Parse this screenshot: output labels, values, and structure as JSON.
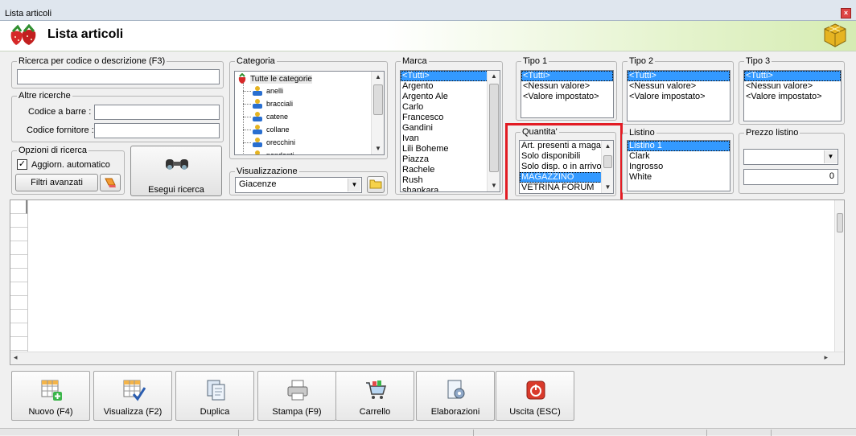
{
  "window": {
    "title": "Lista articoli",
    "header": "Lista articoli"
  },
  "search": {
    "legend": "Ricerca per codice o descrizione (F3)",
    "value": ""
  },
  "altre": {
    "legend": "Altre ricerche",
    "barcode_label": "Codice a barre :",
    "fornitore_label": "Codice fornitore :"
  },
  "opzioni": {
    "legend": "Opzioni di ricerca",
    "auto_label": "Aggiorn. automatico",
    "auto_checked": true,
    "filtri_label": "Filtri avanzati"
  },
  "esegui_label": "Esegui ricerca",
  "categoria": {
    "legend": "Categoria",
    "root": "Tutte le categorie",
    "items": [
      "anelli",
      "bracciali",
      "catene",
      "collane",
      "orecchini",
      "pendenti"
    ]
  },
  "visualizzazione": {
    "legend": "Visualizzazione",
    "selected": "Giacenze"
  },
  "marca": {
    "legend": "Marca",
    "items": [
      "<Tutti>",
      "Argento",
      "Argento Ale",
      "Carlo",
      "Francesco",
      "Gandini",
      "Ivan",
      "Lili Boheme",
      "Piazza",
      "Rachele",
      "Rush",
      "shankara"
    ],
    "selected_index": 0
  },
  "tipo1": {
    "legend": "Tipo 1",
    "items": [
      "<Tutti>",
      "<Nessun valore>",
      "<Valore impostato>"
    ],
    "selected_index": 0
  },
  "tipo2": {
    "legend": "Tipo 2",
    "items": [
      "<Tutti>",
      "<Nessun valore>",
      "<Valore impostato>"
    ],
    "selected_index": 0
  },
  "tipo3": {
    "legend": "Tipo 3",
    "items": [
      "<Tutti>",
      "<Nessun valore>",
      "<Valore impostato>"
    ],
    "selected_index": 0
  },
  "quantita": {
    "legend": "Quantita'",
    "items": [
      "Art. presenti a magaz",
      "Solo disponibili",
      "Solo disp. o in arrivo",
      "MAGAZZINO",
      "VETRINA FORUM"
    ],
    "selected_index": 3
  },
  "listino": {
    "legend": "Listino",
    "items": [
      "Listino 1",
      "Clark",
      "Ingrosso",
      "White"
    ],
    "selected_index": 0
  },
  "prezzo": {
    "legend": "Prezzo listino",
    "combo_value": "",
    "value": "0"
  },
  "toolbar": [
    {
      "label": "Nuovo (F4)",
      "icon": "new-grid-icon"
    },
    {
      "label": "Visualizza (F2)",
      "icon": "view-grid-icon"
    },
    {
      "label": "Duplica",
      "icon": "duplicate-icon"
    },
    {
      "label": "Stampa (F9)",
      "icon": "printer-icon"
    },
    {
      "label": "Carrello",
      "icon": "cart-icon"
    },
    {
      "label": "Elaborazioni",
      "icon": "gear-document-icon"
    },
    {
      "label": "Uscita (ESC)",
      "icon": "power-icon"
    }
  ],
  "colors": {
    "selection": "#3399ff",
    "highlight": "#e21b23"
  }
}
